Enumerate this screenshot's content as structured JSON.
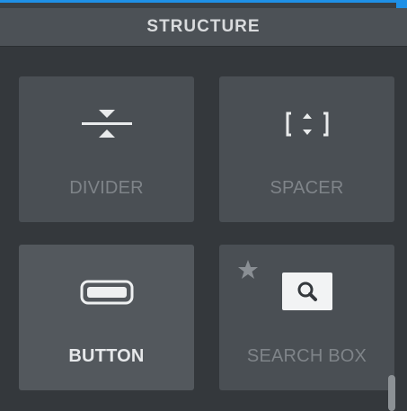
{
  "panel": {
    "title": "STRUCTURE"
  },
  "widgets": [
    {
      "label": "DIVIDER",
      "icon": "divider-icon"
    },
    {
      "label": "SPACER",
      "icon": "spacer-icon"
    },
    {
      "label": "BUTTON",
      "icon": "button-icon"
    },
    {
      "label": "SEARCH BOX",
      "icon": "search-box-icon",
      "favorite_icon": "star-icon"
    }
  ],
  "colors": {
    "accent": "#1e90e6",
    "panel_bg": "#34383c",
    "tile_bg": "#4a4f54",
    "tile_active_bg": "#53585d",
    "header_bg": "#4c5156"
  }
}
